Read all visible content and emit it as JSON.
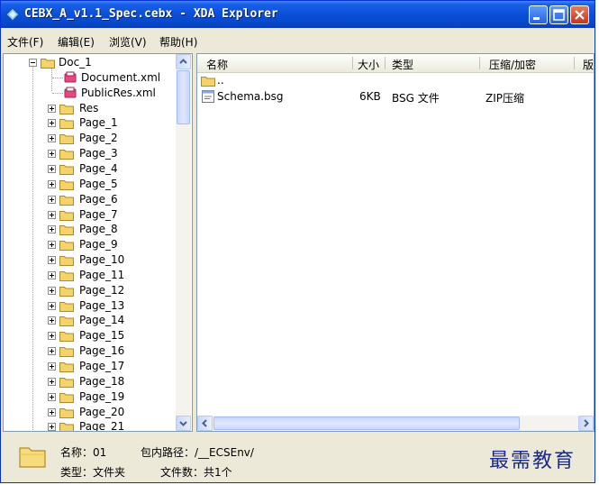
{
  "window": {
    "title": "CEBX_A_v1.1_Spec.cebx - XDA Explorer",
    "buttons": {
      "minimize": "minimize-icon",
      "maximize": "maximize-icon",
      "close": "close-icon"
    }
  },
  "menu": [
    {
      "label": "文件(F)"
    },
    {
      "label": "编辑(E)"
    },
    {
      "label": "浏览(V)"
    },
    {
      "label": "帮助(H)"
    }
  ],
  "tree": {
    "root": "Doc_1",
    "files": [
      "Document.xml",
      "PublicRes.xml"
    ],
    "folders": [
      "Res",
      "Page_1",
      "Page_2",
      "Page_3",
      "Page_4",
      "Page_5",
      "Page_6",
      "Page_7",
      "Page_8",
      "Page_9",
      "Page_10",
      "Page_11",
      "Page_12",
      "Page_13",
      "Page_14",
      "Page_15",
      "Page_16",
      "Page_17",
      "Page_18",
      "Page_19",
      "Page_20",
      "Page_21"
    ]
  },
  "list": {
    "columns": [
      "名称",
      "大小",
      "类型",
      "压缩/加密",
      "版"
    ],
    "rows": [
      {
        "name": "..",
        "size": "",
        "type": "",
        "compress": ""
      },
      {
        "name": "Schema.bsg",
        "size": "6KB",
        "type": "BSG 文件",
        "compress": "ZIP压缩"
      }
    ]
  },
  "status": {
    "name_label": "名称：01",
    "path_label": "包内路径：/__ECSEnv/",
    "type_label": "类型：文件夹",
    "count_label": "文件数：共1个"
  },
  "watermark": "最需教育",
  "colors": {
    "titlebar": "#0a4fd8",
    "accent": "#316ac5",
    "folder": "#f5d36b"
  }
}
